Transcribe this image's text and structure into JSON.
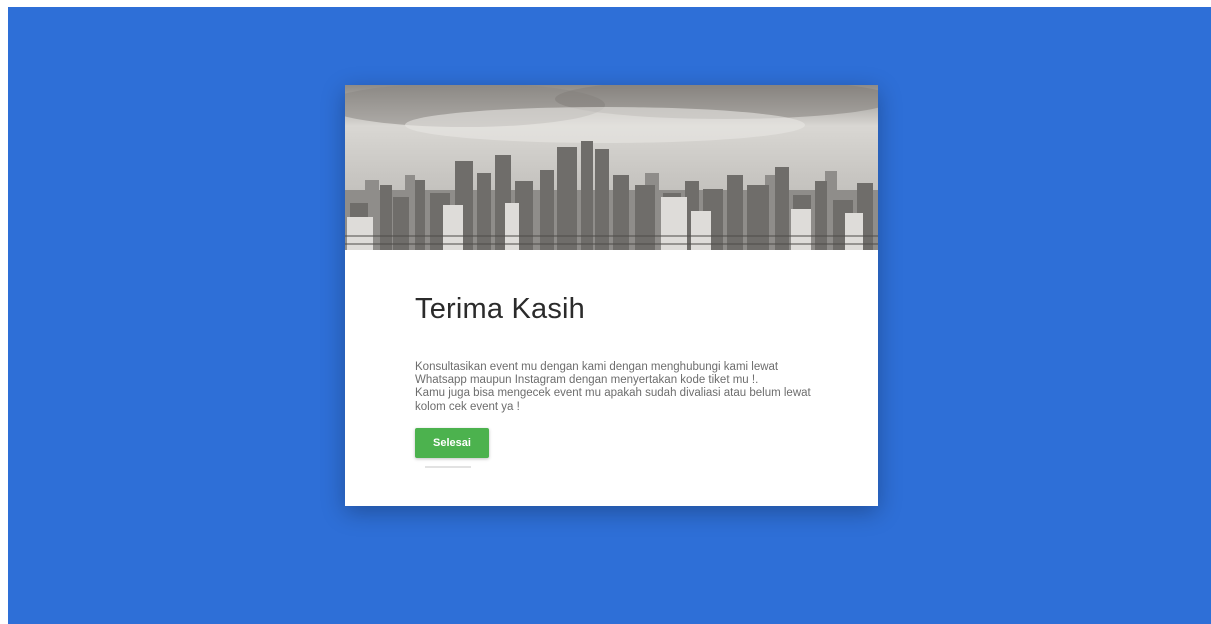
{
  "page": {
    "background_color": "#2e6fd7"
  },
  "card": {
    "hero_image": "city-skyline-grayscale",
    "title": "Terima Kasih",
    "message": "Konsultasikan event mu dengan kami dengan menghubungi kami lewat\nWhatsapp maupun Instagram dengan menyertakan kode tiket mu !.\nKamu juga bisa mengecek event mu apakah sudah divaliasi atau belum lewat\nkolom cek event ya !",
    "button_label": "Selesai",
    "button_color": "#4cb24e"
  }
}
